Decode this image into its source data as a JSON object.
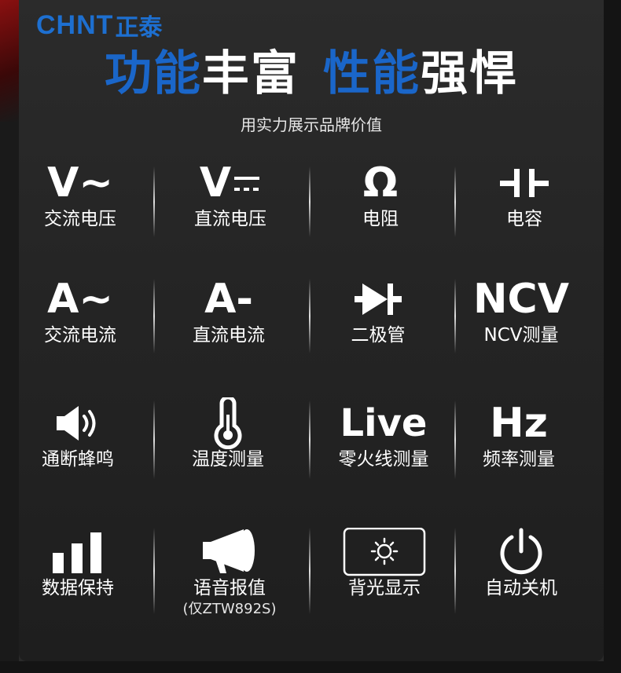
{
  "brand": {
    "latin": "CHNT",
    "chinese": "正泰"
  },
  "headline": {
    "part1": "功能",
    "part2": "丰富",
    "part3": "性能",
    "part4": "强悍"
  },
  "subtitle": "用实力展示品牌价值",
  "features": [
    {
      "icon_text": "V~",
      "label": "交流电压"
    },
    {
      "icon_text": "V",
      "label": "直流电压"
    },
    {
      "icon_text": "Ω",
      "label": "电阻"
    },
    {
      "icon": "capacitor-icon",
      "label": "电容"
    },
    {
      "icon_text": "A~",
      "label": "交流电流"
    },
    {
      "icon_text": "A-",
      "label": "直流电流"
    },
    {
      "icon": "diode-icon",
      "label": "二极管"
    },
    {
      "icon_text": "NCV",
      "label": "NCV测量"
    },
    {
      "icon": "speaker-icon",
      "label": "通断蜂鸣"
    },
    {
      "icon": "thermometer-icon",
      "label": "温度测量"
    },
    {
      "icon_text": "Live",
      "label": "零火线测量"
    },
    {
      "icon_text": "Hz",
      "label": "频率测量"
    },
    {
      "icon": "bar-chart-icon",
      "label": "数据保持"
    },
    {
      "icon": "megaphone-icon",
      "label": "语音报值",
      "note": "(仅ZTW892S)"
    },
    {
      "icon": "backlight-icon",
      "label": "背光显示"
    },
    {
      "icon": "power-icon",
      "label": "自动关机"
    }
  ]
}
